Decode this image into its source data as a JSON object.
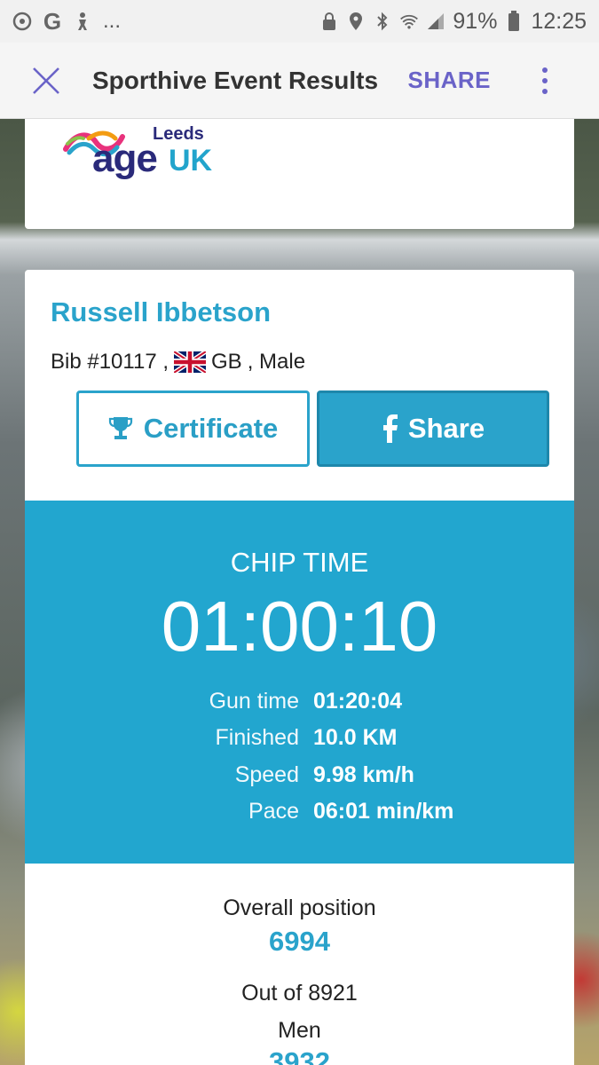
{
  "status_bar": {
    "battery": "91%",
    "time": "12:25",
    "overflow": "..."
  },
  "app_bar": {
    "title": "Sporthive Event Results",
    "share_label": "SHARE"
  },
  "logo": {
    "leeds": "Leeds",
    "age": "age",
    "uk": "UK"
  },
  "runner": {
    "name": "Russell Ibbetson",
    "bib": "Bib #10117 ,",
    "country": "GB",
    "gender": ", Male"
  },
  "buttons": {
    "certificate": "Certificate",
    "share": "Share"
  },
  "timing": {
    "chip_label": "CHIP TIME",
    "chip_time": "01:00:10",
    "rows": [
      {
        "label": "Gun time",
        "value": "01:20:04"
      },
      {
        "label": "Finished",
        "value": "10.0 KM"
      },
      {
        "label": "Speed",
        "value": "9.98 km/h"
      },
      {
        "label": "Pace",
        "value": "06:01 min/km"
      }
    ]
  },
  "position": {
    "overall_label": "Overall position",
    "overall_value": "6994",
    "out_of": "Out of 8921",
    "category_label": "Men",
    "category_value": "3932"
  },
  "colors": {
    "accent": "#22a6cf",
    "share_link": "#6a63c8",
    "logo_navy": "#2a2a7a"
  },
  "icons": [
    "close-icon",
    "more-vertical-icon",
    "trophy-icon",
    "facebook-icon",
    "uk-flag-icon",
    "wifi-icon",
    "signal-icon",
    "battery-icon",
    "bluetooth-icon",
    "location-icon"
  ]
}
